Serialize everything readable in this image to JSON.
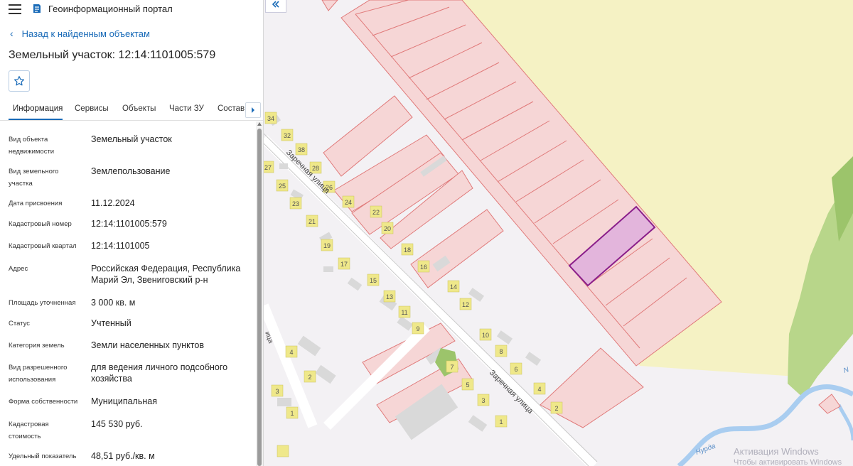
{
  "app": {
    "title": "Геоинформационный портал"
  },
  "nav": {
    "back_label": "Назад к найденным объектам"
  },
  "page": {
    "title": "Земельный участок: 12:14:1101005:579"
  },
  "tabs": [
    {
      "label": "Информация",
      "active": true
    },
    {
      "label": "Сервисы"
    },
    {
      "label": "Объекты"
    },
    {
      "label": "Части ЗУ"
    },
    {
      "label": "Состав"
    }
  ],
  "properties": [
    {
      "key": "Вид объекта недвижимости",
      "value": "Земельный участок"
    },
    {
      "key": "Вид земельного участка",
      "value": "Землепользование"
    },
    {
      "key": "Дата присвоения",
      "value": "11.12.2024"
    },
    {
      "key": "Кадастровый номер",
      "value": "12:14:1101005:579"
    },
    {
      "key": "Кадастровый квартал",
      "value": "12:14:1101005"
    },
    {
      "key": "Адрес",
      "value": "Российская Федерация, Республика Марий Эл, Звениговский р-н"
    },
    {
      "key": "Площадь уточненная",
      "value": "3 000 кв. м"
    },
    {
      "key": "Статус",
      "value": "Учтенный"
    },
    {
      "key": "Категория земель",
      "value": "Земли населенных пунктов"
    },
    {
      "key": "Вид разрешенного использования",
      "value": "для ведения личного подсобного хозяйства"
    },
    {
      "key": "Форма собственности",
      "value": "Муниципальная"
    },
    {
      "key": "Кадастровая стоимость",
      "value": "145 530 руб."
    },
    {
      "key": "Удельный показатель",
      "value": "48,51 руб./кв. м"
    }
  ],
  "map": {
    "street_label": "Заречная улица",
    "river_label": "Нурда",
    "house_numbers": [
      "34",
      "32",
      "38",
      "27",
      "28",
      "26",
      "25",
      "24",
      "23",
      "22",
      "21",
      "20",
      "19",
      "18",
      "17",
      "16",
      "15",
      "14",
      "13",
      "12",
      "11",
      "10",
      "9",
      "8",
      "7",
      "6",
      "5",
      "4",
      "3",
      "2",
      "1"
    ],
    "colors": {
      "parcel_fill": "#f6d6d6",
      "parcel_stroke": "#e07a7a",
      "selected_fill": "#e3b5dc",
      "selected_stroke": "#8a1e8a",
      "field": "#f5f2c4",
      "forest": "#b8d68a",
      "water": "#a9cdf0",
      "building": "#d9d9d9",
      "address_point": "#efe88a"
    }
  },
  "watermark": {
    "line1": "Активация Windows",
    "line2": "Чтобы активировать Windows"
  }
}
